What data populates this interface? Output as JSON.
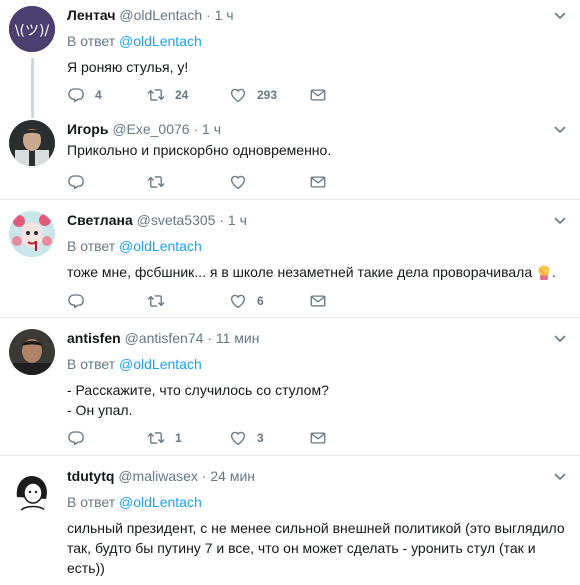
{
  "tweets": [
    {
      "name": "Лентач",
      "handle": "@oldLentach",
      "dot": "·",
      "time": "1 ч",
      "reply_prefix": "В ответ",
      "reply_mention": "@oldLentach",
      "text": "Я роняю стулья, у!",
      "replies": "4",
      "retweets": "24",
      "likes": "293"
    },
    {
      "name": "Игорь",
      "handle": "@Exe_0076",
      "dot": "·",
      "time": "1 ч",
      "text": "Прикольно и прискорбно одновременно.",
      "replies": "",
      "retweets": "",
      "likes": ""
    },
    {
      "name": "Светлана",
      "handle": "@sveta5305",
      "dot": "·",
      "time": "1 ч",
      "reply_prefix": "В ответ",
      "reply_mention": "@oldLentach",
      "text": "тоже мне, фсбшник... я в школе незаметней такие дела проворачивала",
      "text_end": ".",
      "replies": "",
      "retweets": "",
      "likes": "6"
    },
    {
      "name": "antisfen",
      "handle": "@antisfen74",
      "dot": "·",
      "time": "11 мин",
      "reply_prefix": "В ответ",
      "reply_mention": "@oldLentach",
      "text_line1": "- Расскажите, что случилось со стулом?",
      "text_line2": "- Он упал.",
      "replies": "",
      "retweets": "1",
      "likes": "3"
    },
    {
      "name": "tdutytq",
      "handle": "@maliwasex",
      "dot": "·",
      "time": "24 мин",
      "reply_prefix": "В ответ",
      "reply_mention": "@oldLentach",
      "text": "сильный президент, с не менее  сильной внешней политикой (это выглядило так, будто бы путину 7 и все, что он может сделать - уронить стул (так и есть))"
    }
  ],
  "icons": {
    "reply": "reply-icon",
    "retweet": "retweet-icon",
    "like": "heart-icon",
    "dm": "envelope-icon",
    "more": "chevron-down-icon"
  },
  "colors": {
    "accent": "#1da1f2",
    "muted": "#657786",
    "thread_line": "#ccd6dd",
    "lentach_avatar_bg": "#4a3f6e"
  }
}
